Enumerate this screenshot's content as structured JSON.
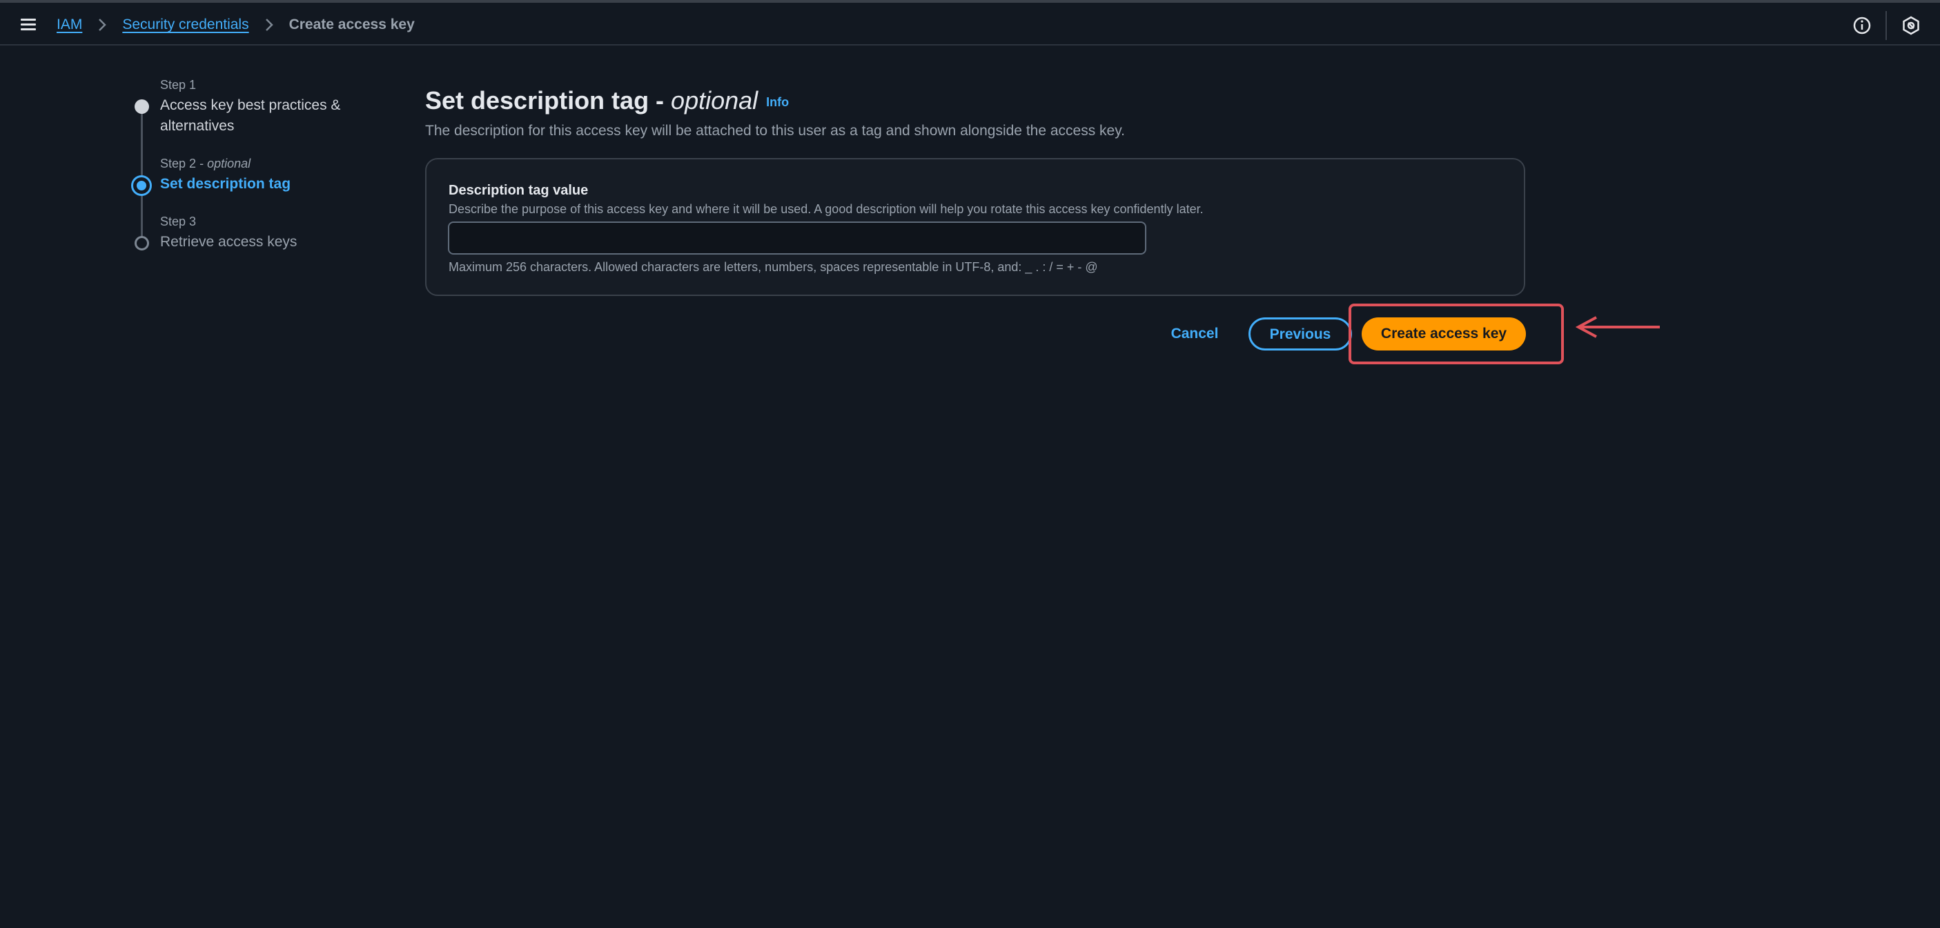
{
  "topbar": {
    "breadcrumb": [
      "IAM",
      "Security credentials",
      "Create access key"
    ],
    "info_icon": "info-icon",
    "settings_icon": "hexagon-settings-icon"
  },
  "stepper": {
    "steps": [
      {
        "label": "Step 1",
        "optional": "",
        "title": "Access key best practices &",
        "title_line2": "alternatives",
        "state": "completed"
      },
      {
        "label": "Step 2",
        "optional": "optional",
        "title": "Set description tag",
        "state": "current"
      },
      {
        "label": "Step 3",
        "optional": "",
        "title": "Retrieve access keys",
        "state": "pending"
      }
    ]
  },
  "main": {
    "title": "Set description tag - ",
    "title_optional": "optional",
    "info_label": "Info",
    "description": "The description for this access key will be attached to this user as a tag and shown alongside the access key."
  },
  "panel": {
    "field_label": "Description tag value",
    "field_description": "Describe the purpose of this access key and where it will be used. A good description will help you rotate this access key confidently later.",
    "field_value": "",
    "field_constraint": "Maximum 256 characters. Allowed characters are letters, numbers, spaces representable in UTF-8, and: _ . : / = + - @"
  },
  "actions": {
    "cancel": "Cancel",
    "previous": "Previous",
    "create": "Create access key"
  },
  "colors": {
    "background": "#121821",
    "link": "#43aefa",
    "primary_button": "#ff9900",
    "highlight": "#e0525a"
  }
}
